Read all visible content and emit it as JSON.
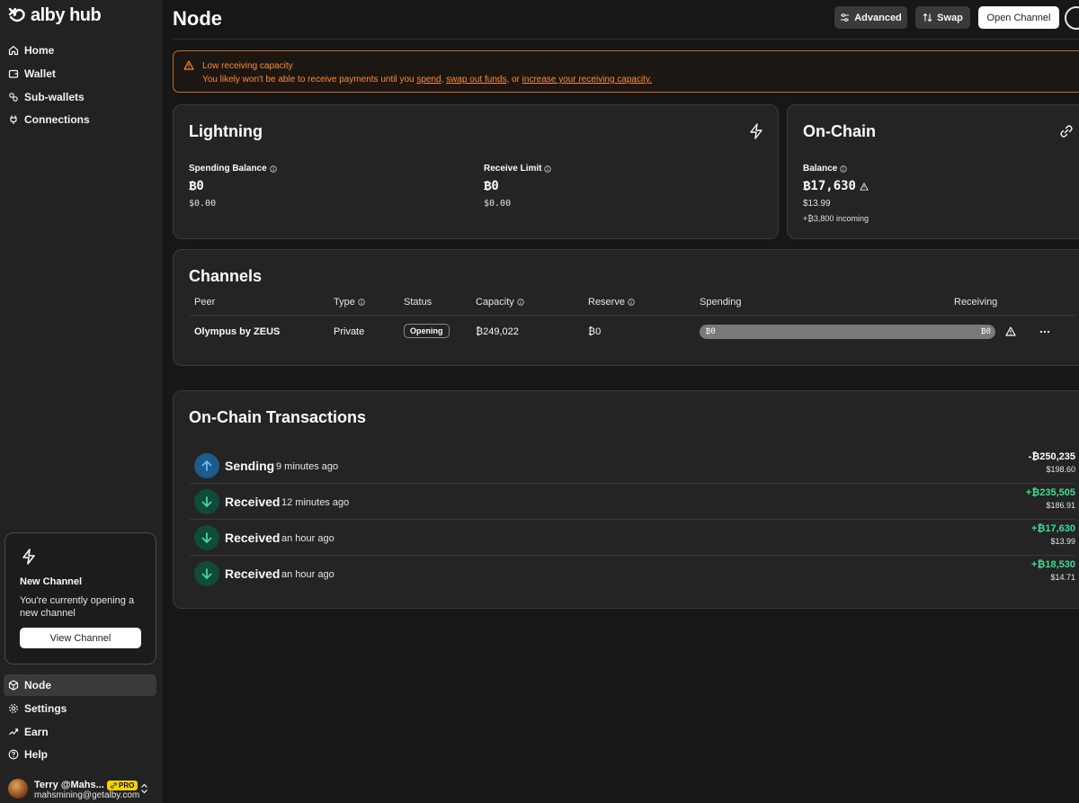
{
  "sidebar": {
    "brand": "alby hub",
    "nav_top": [
      {
        "label": "Home",
        "icon": "home-icon"
      },
      {
        "label": "Wallet",
        "icon": "wallet-icon"
      },
      {
        "label": "Sub-wallets",
        "icon": "sub-wallets-icon"
      },
      {
        "label": "Connections",
        "icon": "plug-icon"
      }
    ],
    "new_channel": {
      "title": "New Channel",
      "desc": "You're currently opening a new channel",
      "button": "View Channel"
    },
    "nav_bottom": [
      {
        "label": "Node",
        "icon": "node-icon",
        "active": true
      },
      {
        "label": "Settings",
        "icon": "settings-icon"
      },
      {
        "label": "Earn",
        "icon": "earn-icon"
      },
      {
        "label": "Help",
        "icon": "help-icon"
      }
    ],
    "user": {
      "name": "Terry @Mahs...",
      "email": "mahsmining@getalby.com",
      "badge": "PRO"
    }
  },
  "header": {
    "title": "Node",
    "advanced": "Advanced",
    "swap": "Swap",
    "open_channel": "Open Channel"
  },
  "alert": {
    "title": "Low receiving capacity",
    "text_pre": "You likely won't be able to receive payments until you",
    "link1": "spend",
    "sep1": ",",
    "link2": "swap out funds",
    "sep2": ", or",
    "link3": "increase your receiving capacity.",
    "color": "#ff8a2b"
  },
  "lightning": {
    "title": "Lightning",
    "spending_label": "Spending Balance",
    "spending_value": "₿0",
    "spending_usd": "$0.00",
    "receive_label": "Receive Limit",
    "receive_value": "₿0",
    "receive_usd": "$0.00"
  },
  "onchain": {
    "title": "On-Chain",
    "balance_label": "Balance",
    "balance_value": "₿17,630",
    "balance_usd": "$13.99",
    "incoming": "+₿3,800 incoming"
  },
  "channels": {
    "title": "Channels",
    "headers": {
      "peer": "Peer",
      "type": "Type",
      "status": "Status",
      "capacity": "Capacity",
      "reserve": "Reserve",
      "spending": "Spending",
      "receiving": "Receiving"
    },
    "row": {
      "peer": "Olympus by ZEUS",
      "type": "Private",
      "status": "Opening",
      "capacity": "₿249,022",
      "reserve": "₿0",
      "spend_amount": "₿0",
      "receive_amount": "₿0"
    }
  },
  "transactions": {
    "title": "On-Chain Transactions",
    "items": [
      {
        "type": "Sending",
        "ago": "9 minutes ago",
        "amount": "-₿250,235",
        "fiat": "$198.60",
        "direction": "out"
      },
      {
        "type": "Received",
        "ago": "12 minutes ago",
        "amount": "+₿235,505",
        "fiat": "$186.91",
        "direction": "in"
      },
      {
        "type": "Received",
        "ago": "an hour ago",
        "amount": "+₿17,630",
        "fiat": "$13.99",
        "direction": "in"
      },
      {
        "type": "Received",
        "ago": "an hour ago",
        "amount": "+₿18,530",
        "fiat": "$14.71",
        "direction": "in"
      }
    ],
    "colors": {
      "in": "#3ddc97",
      "out": "#ffffff",
      "in_bg": "#0f4a3a",
      "out_bg": "#1e5a8a"
    }
  }
}
